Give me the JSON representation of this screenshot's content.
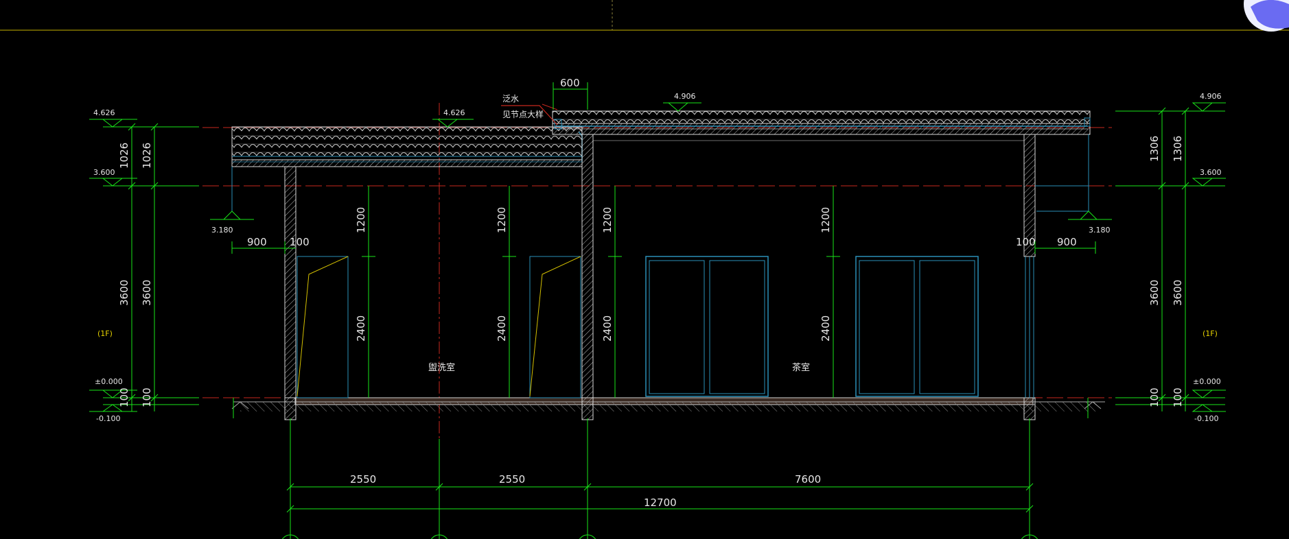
{
  "colors": {
    "background": "#000000",
    "dimension_green": "#19e619",
    "wall_white": "#e0e0e0",
    "centerline_red": "#c8281e",
    "window_cyan": "#2a8fb8",
    "header_line": "#c8b400",
    "door_yellow": "#d4c000"
  },
  "rooms": {
    "washroom": "盥洗室",
    "tea_room": "茶室"
  },
  "annotations": {
    "flashing": "泛水",
    "see_detail": "见节点大样"
  },
  "levels": {
    "left_eave_top": "4.626",
    "mid_eave_top": "4.626",
    "right_roof_top": "4.906",
    "right_roof_top_far": "4.906",
    "left_eave": "3.600",
    "right_eave": "3.600",
    "left_soffit": "3.180",
    "right_soffit": "3.180",
    "left_ground": "±0.000",
    "right_ground": "±0.000",
    "left_outdoor": "-0.100",
    "right_outdoor": "-0.100"
  },
  "floor_tags": {
    "left": "(1F)",
    "right": "(1F)"
  },
  "dimensions": {
    "parapet_600": "600",
    "left_roof_h_a": "1026",
    "left_roof_h_b": "1026",
    "right_roof_h_a": "1306",
    "right_roof_h_b": "1306",
    "left_floor_h_a": "3600",
    "left_floor_h_b": "3600",
    "right_floor_h_a": "3600",
    "right_floor_h_b": "3600",
    "left_base_a": "100",
    "left_base_b": "100",
    "right_base_a": "100",
    "right_base_b": "100",
    "left_overhang": "900",
    "left_wall": "100",
    "right_wall": "100",
    "right_overhang": "900",
    "win_top_1": "1200",
    "win_top_2": "1200",
    "win_top_3": "1200",
    "win_top_4": "1200",
    "win_low_1": "2400",
    "win_low_2": "2400",
    "win_low_3": "2400",
    "win_low_4": "2400",
    "bay_1": "2550",
    "bay_2": "2550",
    "bay_3": "7600",
    "total": "12700"
  }
}
